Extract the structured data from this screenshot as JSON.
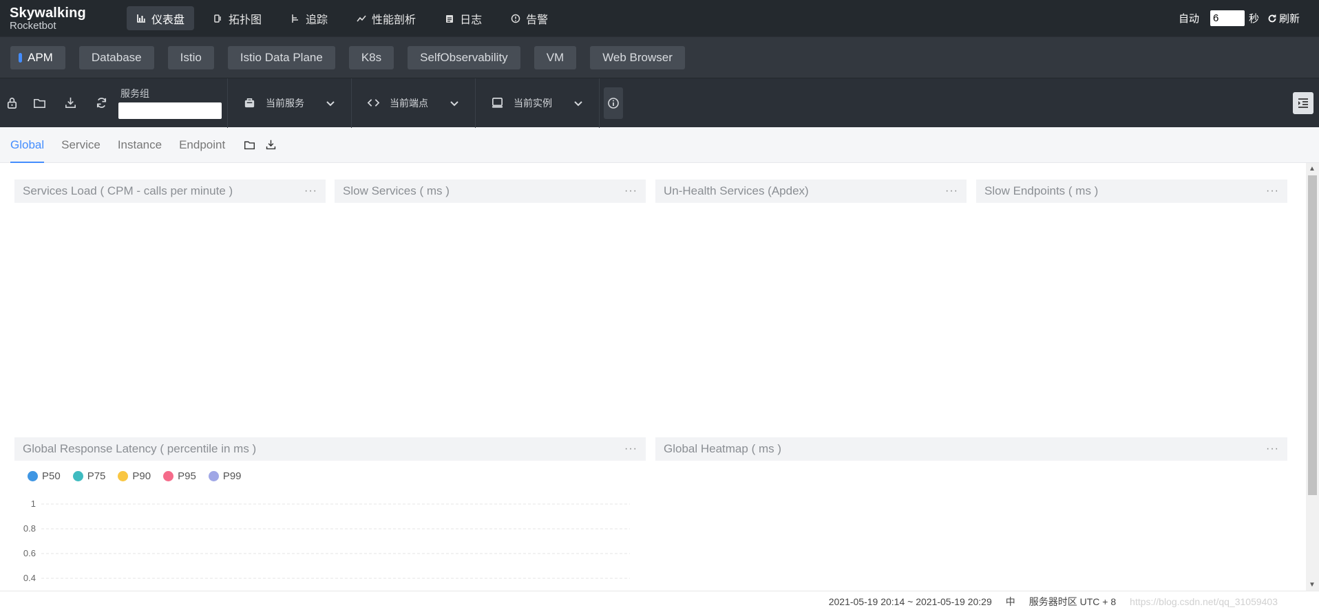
{
  "brand": {
    "line1": "Skywalking",
    "line2": "Rocketbot"
  },
  "nav": [
    {
      "label": "仪表盘",
      "icon": "bar-chart-icon",
      "active": true
    },
    {
      "label": "拓扑图",
      "icon": "topology-icon",
      "active": false
    },
    {
      "label": "追踪",
      "icon": "trace-icon",
      "active": false
    },
    {
      "label": "性能剖析",
      "icon": "profile-icon",
      "active": false
    },
    {
      "label": "日志",
      "icon": "log-icon",
      "active": false
    },
    {
      "label": "告警",
      "icon": "alarm-icon",
      "active": false
    }
  ],
  "auto_refresh": {
    "label": "自动",
    "value": "6",
    "unit": "秒",
    "refresh_label": "刷新"
  },
  "layers": [
    "APM",
    "Database",
    "Istio",
    "Istio Data Plane",
    "K8s",
    "SelfObservability",
    "VM",
    "Web Browser"
  ],
  "toolbar": {
    "service_group_label": "服务组",
    "service_group_value": "",
    "current_service": "当前服务",
    "current_endpoint": "当前端点",
    "current_instance": "当前实例"
  },
  "tabs": [
    "Global",
    "Service",
    "Instance",
    "Endpoint"
  ],
  "panels": {
    "p1": "Services Load ( CPM - calls per minute )",
    "p2": "Slow Services ( ms )",
    "p3": "Un-Health Services (Apdex)",
    "p4": "Slow Endpoints ( ms )",
    "p5": "Global Response Latency ( percentile in ms )",
    "p6": "Global Heatmap ( ms )",
    "more": "···"
  },
  "chart_data": {
    "type": "line",
    "title": "Global Response Latency ( percentile in ms )",
    "series": [
      {
        "name": "P50",
        "color": "#3f96e3",
        "values": []
      },
      {
        "name": "P75",
        "color": "#3fbbc0",
        "values": []
      },
      {
        "name": "P90",
        "color": "#f9c642",
        "values": []
      },
      {
        "name": "P95",
        "color": "#f56b8a",
        "values": []
      },
      {
        "name": "P99",
        "color": "#a0a7e6",
        "values": []
      }
    ],
    "y_ticks": [
      "1",
      "0.8",
      "0.6",
      "0.4"
    ],
    "ylim": [
      0.4,
      1
    ],
    "grid": true,
    "legend": "top-left"
  },
  "footer": {
    "time_range": "2021-05-19 20:14 ~ 2021-05-19 20:29",
    "lang": "中",
    "timezone": "服务器时区 UTC + 8",
    "watermark": "https://blog.csdn.net/qq_31059403"
  },
  "colors": {
    "accent": "#448dfe",
    "topbar": "#24292e",
    "layerbar": "#33383f",
    "toolbar": "#2b3037"
  }
}
